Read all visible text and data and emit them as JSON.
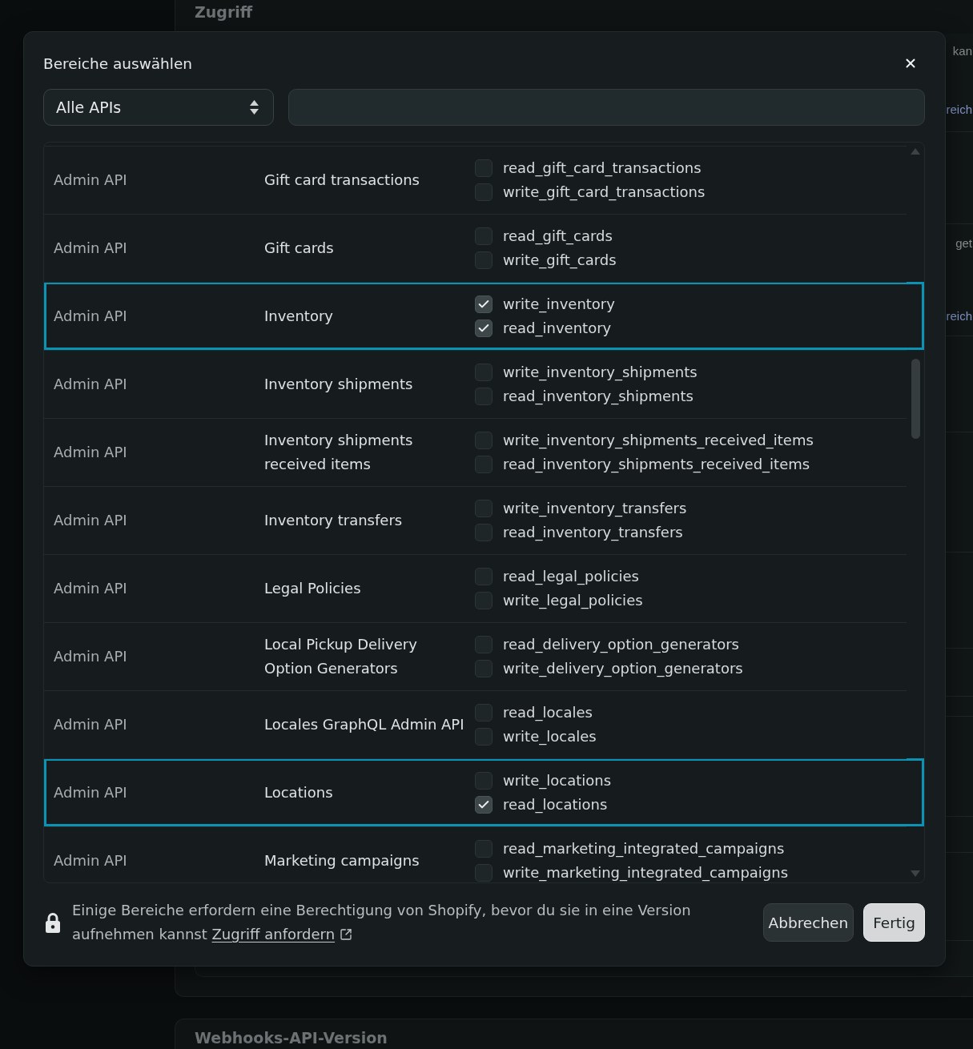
{
  "background": {
    "heading": "Zugriff",
    "fragments": [
      {
        "text": "kan",
        "kind": "text"
      },
      {
        "text": "reich",
        "kind": "link"
      },
      {
        "text": "get",
        "kind": "text"
      },
      {
        "text": "reich",
        "kind": "link"
      }
    ],
    "next_heading": "Webhooks-API-Version"
  },
  "dialog": {
    "title": "Bereiche auswählen",
    "api_filter": {
      "value": "Alle APIs"
    },
    "scopes_table": {
      "rows": [
        {
          "api": "Admin API",
          "name": "Gift card transactions",
          "highlighted": false,
          "scopes": [
            {
              "label": "read_gift_card_transactions",
              "checked": false
            },
            {
              "label": "write_gift_card_transactions",
              "checked": false
            }
          ]
        },
        {
          "api": "Admin API",
          "name": "Gift cards",
          "highlighted": false,
          "scopes": [
            {
              "label": "read_gift_cards",
              "checked": false
            },
            {
              "label": "write_gift_cards",
              "checked": false
            }
          ]
        },
        {
          "api": "Admin API",
          "name": "Inventory",
          "highlighted": true,
          "scopes": [
            {
              "label": "write_inventory",
              "checked": true
            },
            {
              "label": "read_inventory",
              "checked": true
            }
          ]
        },
        {
          "api": "Admin API",
          "name": "Inventory shipments",
          "highlighted": false,
          "scopes": [
            {
              "label": "write_inventory_shipments",
              "checked": false
            },
            {
              "label": "read_inventory_shipments",
              "checked": false
            }
          ]
        },
        {
          "api": "Admin API",
          "name": "Inventory shipments received items",
          "highlighted": false,
          "scopes": [
            {
              "label": "write_inventory_shipments_received_items",
              "checked": false
            },
            {
              "label": "read_inventory_shipments_received_items",
              "checked": false
            }
          ]
        },
        {
          "api": "Admin API",
          "name": "Inventory transfers",
          "highlighted": false,
          "scopes": [
            {
              "label": "write_inventory_transfers",
              "checked": false
            },
            {
              "label": "read_inventory_transfers",
              "checked": false
            }
          ]
        },
        {
          "api": "Admin API",
          "name": "Legal Policies",
          "highlighted": false,
          "scopes": [
            {
              "label": "read_legal_policies",
              "checked": false
            },
            {
              "label": "write_legal_policies",
              "checked": false
            }
          ]
        },
        {
          "api": "Admin API",
          "name": "Local Pickup Delivery Option Generators",
          "highlighted": false,
          "scopes": [
            {
              "label": "read_delivery_option_generators",
              "checked": false
            },
            {
              "label": "write_delivery_option_generators",
              "checked": false
            }
          ]
        },
        {
          "api": "Admin API",
          "name": "Locales GraphQL Admin API",
          "highlighted": false,
          "scopes": [
            {
              "label": "read_locales",
              "checked": false
            },
            {
              "label": "write_locales",
              "checked": false
            }
          ]
        },
        {
          "api": "Admin API",
          "name": "Locations",
          "highlighted": true,
          "scopes": [
            {
              "label": "write_locations",
              "checked": false
            },
            {
              "label": "read_locations",
              "checked": true
            }
          ]
        },
        {
          "api": "Admin API",
          "name": "Marketing campaigns",
          "highlighted": false,
          "scopes": [
            {
              "label": "read_marketing_integrated_campaigns",
              "checked": false
            },
            {
              "label": "write_marketing_integrated_campaigns",
              "checked": false
            }
          ]
        }
      ]
    },
    "footer": {
      "notice": "Einige Bereiche erfordern eine Berechtigung von Shopify, bevor du sie in eine Version aufnehmen kannst",
      "link": "Zugriff anfordern"
    },
    "buttons": [
      {
        "label": "Abbrechen",
        "kind": "secondary"
      },
      {
        "label": "Fertig",
        "kind": "primary"
      }
    ]
  }
}
